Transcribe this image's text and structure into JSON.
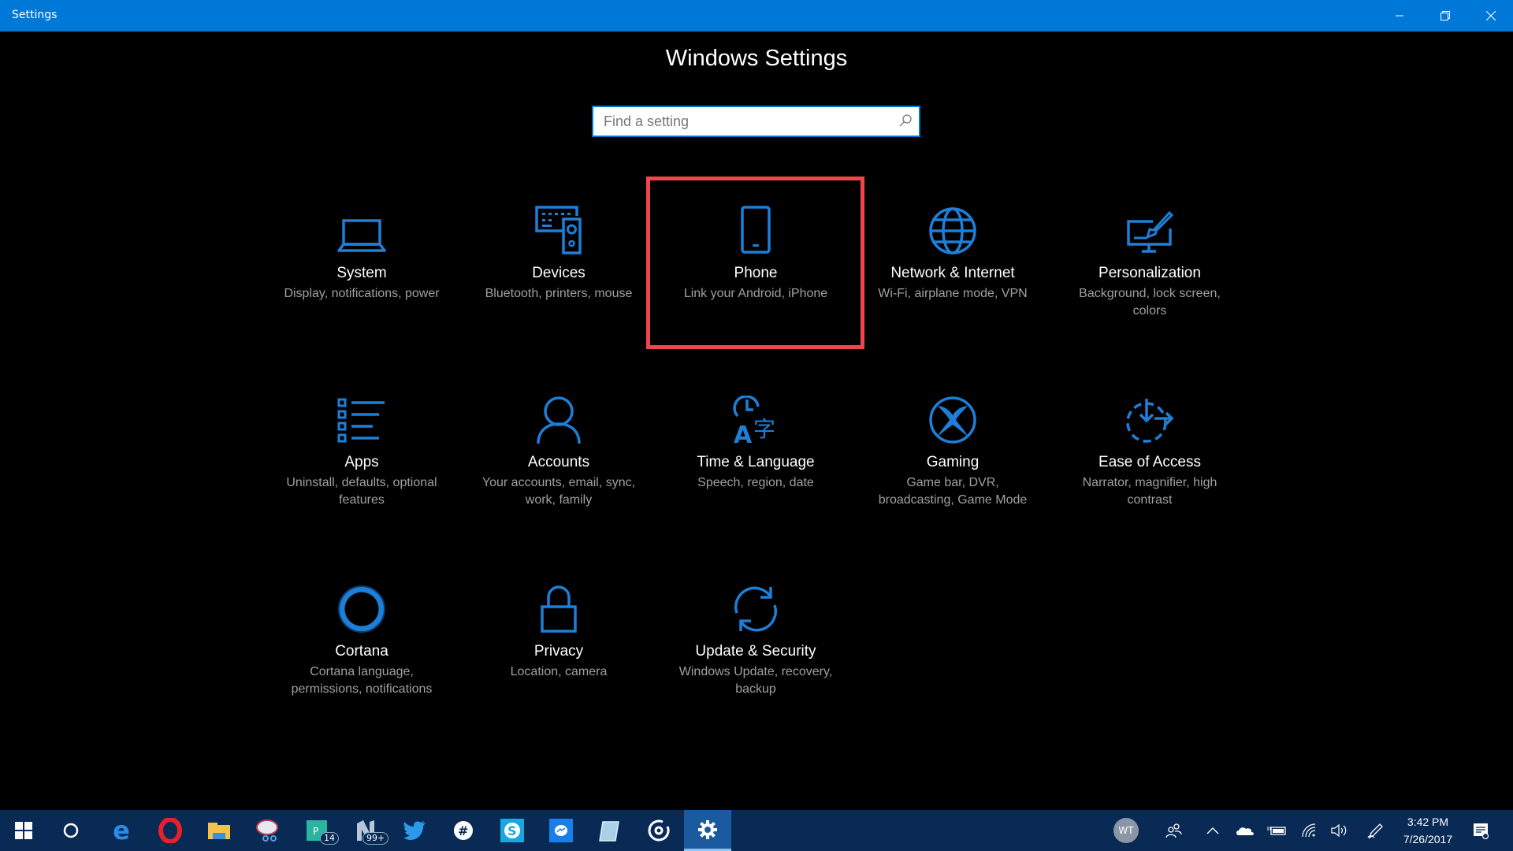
{
  "window": {
    "title": "Settings",
    "controls": [
      "minimize",
      "restore",
      "close"
    ]
  },
  "page": {
    "heading": "Windows Settings",
    "search": {
      "placeholder": "Find a setting",
      "value": ""
    }
  },
  "tiles": [
    {
      "name": "System",
      "desc": "Display, notifications, power",
      "icon": "laptop-icon"
    },
    {
      "name": "Devices",
      "desc": "Bluetooth, printers, mouse",
      "icon": "keyboard-speaker-icon"
    },
    {
      "name": "Phone",
      "desc": "Link your Android, iPhone",
      "icon": "phone-icon",
      "highlighted": true
    },
    {
      "name": "Network & Internet",
      "desc": "Wi-Fi, airplane mode, VPN",
      "icon": "globe-icon"
    },
    {
      "name": "Personalization",
      "desc": "Background, lock screen, colors",
      "icon": "paintbrush-monitor-icon"
    },
    {
      "name": "Apps",
      "desc": "Uninstall, defaults, optional features",
      "icon": "app-list-icon"
    },
    {
      "name": "Accounts",
      "desc": "Your accounts, email, sync, work, family",
      "icon": "person-icon"
    },
    {
      "name": "Time & Language",
      "desc": "Speech, region, date",
      "icon": "clock-language-icon"
    },
    {
      "name": "Gaming",
      "desc": "Game bar, DVR, broadcasting, Game Mode",
      "icon": "xbox-icon"
    },
    {
      "name": "Ease of Access",
      "desc": "Narrator, magnifier, high contrast",
      "icon": "ease-of-access-icon"
    },
    {
      "name": "Cortana",
      "desc": "Cortana language, permissions, notifications",
      "icon": "cortana-icon"
    },
    {
      "name": "Privacy",
      "desc": "Location, camera",
      "icon": "lock-icon"
    },
    {
      "name": "Update & Security",
      "desc": "Windows Update, recovery, backup",
      "icon": "sync-icon"
    }
  ],
  "colors": {
    "accent": "#0078d7",
    "icon_blue": "#1e7fd8",
    "highlight_red": "#f0454a",
    "taskbar": "#0a2a56"
  },
  "taskbar": {
    "apps": [
      {
        "name": "start",
        "icon": "windows-logo-icon"
      },
      {
        "name": "cortana-search",
        "icon": "cortana-circle-icon"
      },
      {
        "name": "edge",
        "icon": "edge-icon"
      },
      {
        "name": "opera",
        "icon": "opera-icon"
      },
      {
        "name": "file-explorer",
        "icon": "folder-icon"
      },
      {
        "name": "snipping-tool",
        "icon": "snipping-tool-icon"
      },
      {
        "name": "app-p",
        "icon": "p-app-icon",
        "badge": "14"
      },
      {
        "name": "app-n",
        "icon": "n-app-icon",
        "badge": "99+"
      },
      {
        "name": "twitter",
        "icon": "twitter-icon"
      },
      {
        "name": "slack",
        "icon": "slack-icon"
      },
      {
        "name": "skype",
        "icon": "skype-icon"
      },
      {
        "name": "messenger",
        "icon": "messenger-icon"
      },
      {
        "name": "notepad",
        "icon": "notepad-icon"
      },
      {
        "name": "groove",
        "icon": "groove-music-icon"
      },
      {
        "name": "settings",
        "icon": "gear-icon",
        "active": true
      }
    ],
    "tray": {
      "avatar_initials": "WT",
      "time": "3:42 PM",
      "date": "7/26/2017"
    }
  }
}
